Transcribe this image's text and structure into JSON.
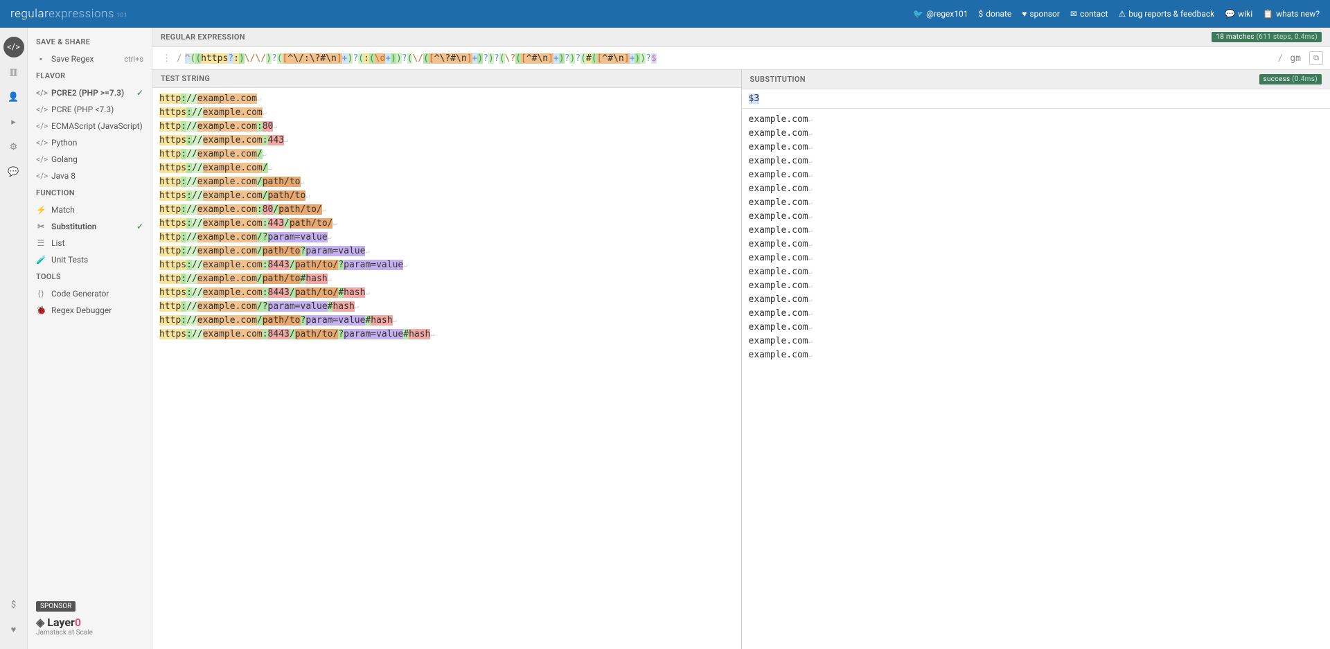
{
  "header": {
    "logo_regular": "regular",
    "logo_expressions": "expressions",
    "logo_sub": "101",
    "links": [
      {
        "icon": "🐦",
        "label": "@regex101",
        "name": "twitter-link"
      },
      {
        "icon": "$",
        "label": "donate",
        "name": "donate-link"
      },
      {
        "icon": "♥",
        "label": "sponsor",
        "name": "sponsor-link"
      },
      {
        "icon": "✉",
        "label": "contact",
        "name": "contact-link"
      },
      {
        "icon": "⚠",
        "label": "bug reports & feedback",
        "name": "bugs-link"
      },
      {
        "icon": "💬",
        "label": "wiki",
        "name": "wiki-link"
      },
      {
        "icon": "📋",
        "label": "whats new?",
        "name": "whatsnew-link"
      }
    ]
  },
  "sidebar": {
    "sections": {
      "save_share": "SAVE & SHARE",
      "flavor": "FLAVOR",
      "function": "FUNCTION",
      "tools": "TOOLS"
    },
    "save_regex": "Save Regex",
    "save_shortcut": "ctrl+s",
    "flavors": [
      {
        "label": "PCRE2 (PHP >=7.3)",
        "selected": true
      },
      {
        "label": "PCRE (PHP <7.3)",
        "selected": false
      },
      {
        "label": "ECMAScript (JavaScript)",
        "selected": false
      },
      {
        "label": "Python",
        "selected": false
      },
      {
        "label": "Golang",
        "selected": false
      },
      {
        "label": "Java 8",
        "selected": false
      }
    ],
    "functions": [
      {
        "icon": "⚡",
        "label": "Match",
        "selected": false
      },
      {
        "icon": "✂",
        "label": "Substitution",
        "selected": true
      },
      {
        "icon": "☰",
        "label": "List",
        "selected": false
      },
      {
        "icon": "🧪",
        "label": "Unit Tests",
        "selected": false
      }
    ],
    "tools": [
      {
        "icon": "⟨⟩",
        "label": "Code Generator"
      },
      {
        "icon": "🐞",
        "label": "Regex Debugger"
      }
    ],
    "sponsor": {
      "badge": "SPONSOR",
      "logo_main": "Layer",
      "logo_zero": "0",
      "tagline": "Jamstack at Scale"
    }
  },
  "content": {
    "regex_label": "REGULAR EXPRESSION",
    "match_badge_main": "18 matches",
    "match_badge_stats": " (611 steps, 0.4ms)",
    "regex_pattern_display": "^((https?:)\\/\\/)?([^\\/:\\?#\\n]+)?(:(\\d+))?(\\/([^\\?#\\n]+)?)?(\\?([^#\\n]+)?)?(#([^#\\n]+))?$",
    "regex_flags": "gm",
    "test_label": "TEST STRING",
    "substitution_label": "SUBSTITUTION",
    "success_main": "success",
    "success_stats": " (0.4ms)",
    "sub_pattern": "$3",
    "test_lines": [
      "http://example.com",
      "https://example.com",
      "http://example.com:80",
      "https://example.com:443",
      "http://example.com/",
      "https://example.com/",
      "http://example.com/path/to",
      "https://example.com/path/to",
      "http://example.com:80/path/to/",
      "https://example.com:443/path/to/",
      "http://example.com/?param=value",
      "http://example.com/path/to?param=value",
      "https://example.com:8443/path/to/?param=value",
      "http://example.com/path/to#hash",
      "https://example.com:8443/path/to/#hash",
      "http://example.com/?param=value#hash",
      "http://example.com/path/to?param=value#hash",
      "https://example.com:8443/path/to/?param=value#hash"
    ],
    "sub_output_line": "example.com",
    "sub_output_count": 18
  }
}
